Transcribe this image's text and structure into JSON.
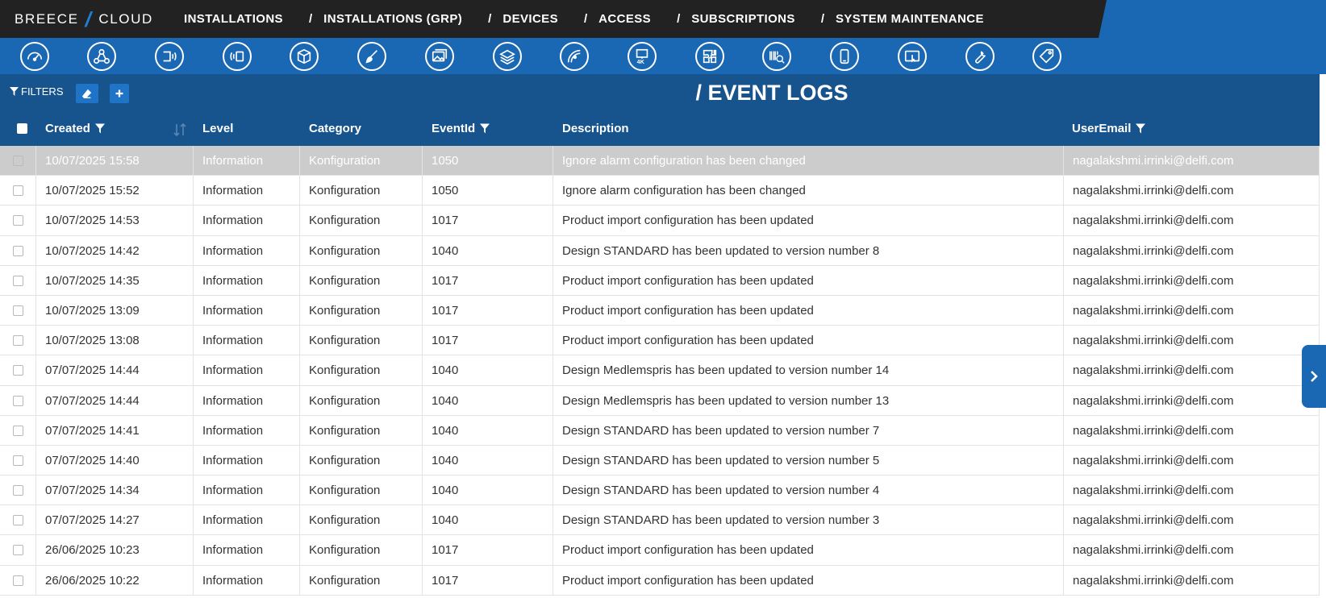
{
  "brand": {
    "left": "BREECE",
    "right": "CLOUD"
  },
  "nav": [
    {
      "label": "INSTALLATIONS"
    },
    {
      "label": "INSTALLATIONS (GRP)"
    },
    {
      "label": "DEVICES"
    },
    {
      "label": "ACCESS"
    },
    {
      "label": "SUBSCRIPTIONS"
    },
    {
      "label": "SYSTEM MAINTENANCE"
    }
  ],
  "nav_separator": "/",
  "toolbar_icons": [
    "dashboard-icon",
    "network-icon",
    "door-sensor-icon",
    "rfid-reader-icon",
    "package-icon",
    "brush-icon",
    "images-icon",
    "layers-icon",
    "signal-icon",
    "monitor-4k-icon",
    "puzzle-icon",
    "barcode-search-icon",
    "mobile-phone-icon",
    "touch-screen-icon",
    "wrench-icon",
    "price-tag-icon"
  ],
  "filters": {
    "label": "FILTERS"
  },
  "page_title": "/ EVENT LOGS",
  "table": {
    "columns": [
      "Created",
      "Level",
      "Category",
      "EventId",
      "Description",
      "UserEmail"
    ],
    "rows": [
      [
        "10/07/2025 15:58",
        "Information",
        "Konfiguration",
        "1050",
        "Ignore alarm configuration has been changed",
        "nagalakshmi.irrinki@delfi.com"
      ],
      [
        "10/07/2025 15:52",
        "Information",
        "Konfiguration",
        "1050",
        "Ignore alarm configuration has been changed",
        "nagalakshmi.irrinki@delfi.com"
      ],
      [
        "10/07/2025 14:53",
        "Information",
        "Konfiguration",
        "1017",
        "Product import configuration has been updated",
        "nagalakshmi.irrinki@delfi.com"
      ],
      [
        "10/07/2025 14:42",
        "Information",
        "Konfiguration",
        "1040",
        "Design STANDARD has been updated to version number 8",
        "nagalakshmi.irrinki@delfi.com"
      ],
      [
        "10/07/2025 14:35",
        "Information",
        "Konfiguration",
        "1017",
        "Product import configuration has been updated",
        "nagalakshmi.irrinki@delfi.com"
      ],
      [
        "10/07/2025 13:09",
        "Information",
        "Konfiguration",
        "1017",
        "Product import configuration has been updated",
        "nagalakshmi.irrinki@delfi.com"
      ],
      [
        "10/07/2025 13:08",
        "Information",
        "Konfiguration",
        "1017",
        "Product import configuration has been updated",
        "nagalakshmi.irrinki@delfi.com"
      ],
      [
        "07/07/2025 14:44",
        "Information",
        "Konfiguration",
        "1040",
        "Design Medlemspris has been updated to version number 14",
        "nagalakshmi.irrinki@delfi.com"
      ],
      [
        "07/07/2025 14:44",
        "Information",
        "Konfiguration",
        "1040",
        "Design Medlemspris has been updated to version number 13",
        "nagalakshmi.irrinki@delfi.com"
      ],
      [
        "07/07/2025 14:41",
        "Information",
        "Konfiguration",
        "1040",
        "Design STANDARD has been updated to version number 7",
        "nagalakshmi.irrinki@delfi.com"
      ],
      [
        "07/07/2025 14:40",
        "Information",
        "Konfiguration",
        "1040",
        "Design STANDARD has been updated to version number 5",
        "nagalakshmi.irrinki@delfi.com"
      ],
      [
        "07/07/2025 14:34",
        "Information",
        "Konfiguration",
        "1040",
        "Design STANDARD has been updated to version number 4",
        "nagalakshmi.irrinki@delfi.com"
      ],
      [
        "07/07/2025 14:27",
        "Information",
        "Konfiguration",
        "1040",
        "Design STANDARD has been updated to version number 3",
        "nagalakshmi.irrinki@delfi.com"
      ],
      [
        "26/06/2025 10:23",
        "Information",
        "Konfiguration",
        "1017",
        "Product import configuration has been updated",
        "nagalakshmi.irrinki@delfi.com"
      ],
      [
        "26/06/2025 10:22",
        "Information",
        "Konfiguration",
        "1017",
        "Product import configuration has been updated",
        "nagalakshmi.irrinki@delfi.com"
      ]
    ],
    "selected_row": 0
  },
  "colors": {
    "topbar": "#222222",
    "accent": "#1a67b3",
    "header": "#17538d",
    "selected_row": "#cccccc"
  }
}
